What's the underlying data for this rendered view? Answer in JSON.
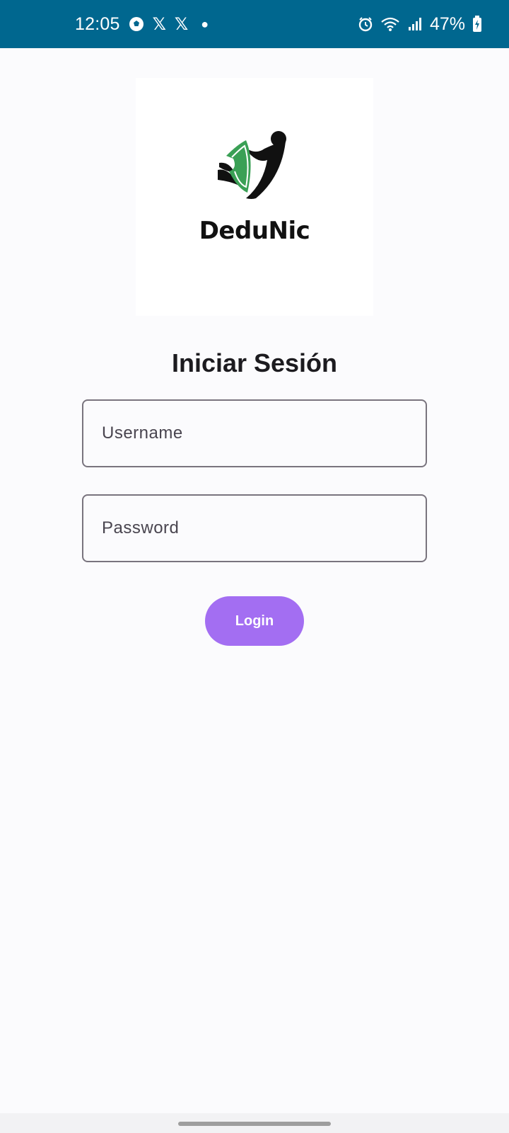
{
  "status_bar": {
    "time": "12:05",
    "battery": "47%",
    "background_color": "#00678f",
    "left_icons": [
      "soccer-ball-icon",
      "x-app-icon",
      "x-app-icon",
      "notification-dot-icon"
    ],
    "right_icons": [
      "alarm-icon",
      "wifi-icon",
      "signal-icon",
      "battery-charging-icon"
    ]
  },
  "logo": {
    "brand_name": "DeduNic"
  },
  "login_form": {
    "title": "Iniciar Sesión",
    "username": {
      "placeholder": "Username",
      "value": ""
    },
    "password": {
      "placeholder": "Password",
      "value": ""
    },
    "login_label": "Login",
    "button_color": "#a36ef2"
  }
}
